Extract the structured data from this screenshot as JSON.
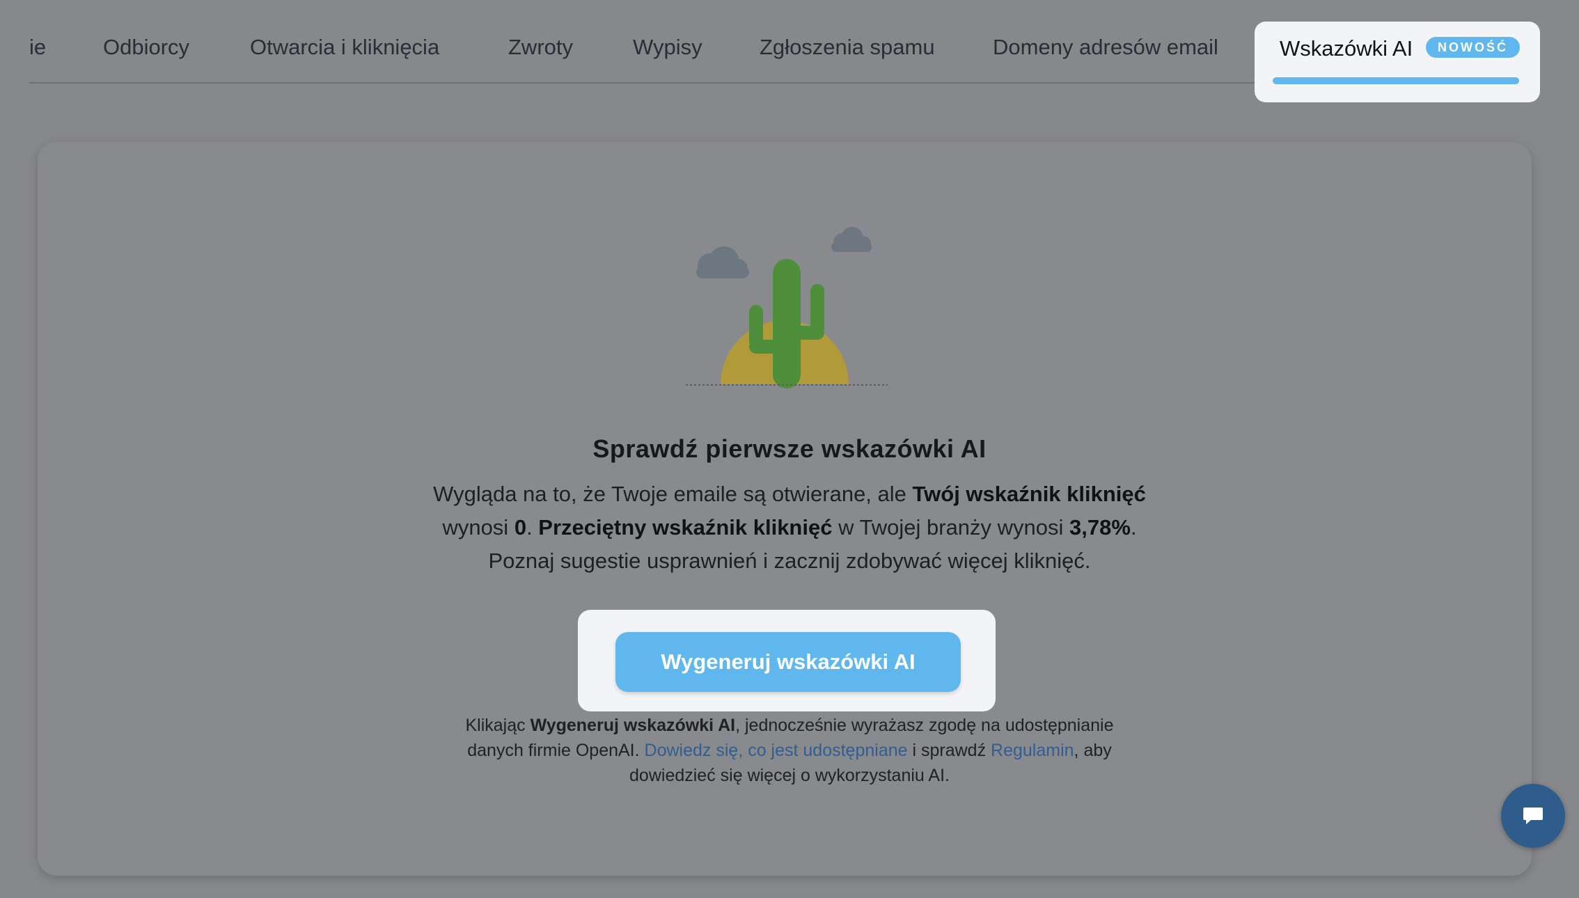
{
  "tabs": [
    {
      "label": "ie"
    },
    {
      "label": "Odbiorcy"
    },
    {
      "label": "Otwarcia i kliknięcia"
    },
    {
      "label": "Zwroty"
    },
    {
      "label": "Wypisy"
    },
    {
      "label": "Zgłoszenia spamu"
    },
    {
      "label": "Domeny adresów email"
    }
  ],
  "active_tab": {
    "label": "Wskazówki AI",
    "badge": "NOWOŚĆ"
  },
  "empty_state": {
    "illustration": "cactus-desert-icon",
    "heading": "Sprawdź pierwsze wskazówki AI",
    "desc_1": "Wygląda na to, że Twoje emaile są otwierane, ale ",
    "desc_bold_1": "Twój wskaźnik kliknięć",
    "desc_2": " wynosi ",
    "desc_bold_2": "0",
    "desc_3": ". ",
    "desc_bold_3": "Przeciętny wskaźnik kliknięć",
    "desc_4": " w Twojej branży wynosi ",
    "desc_bold_4": "3,78%",
    "desc_5": ". Poznaj sugestie usprawnień i zacznij zdobywać więcej kliknięć."
  },
  "cta": {
    "label": "Wygeneruj wskazówki AI"
  },
  "consent": {
    "part_1": "Klikając ",
    "bold": "Wygeneruj wskazówki AI",
    "part_2": ", jednocześnie wyrażasz zgodę na udostępnianie danych firmie OpenAI. ",
    "link_1": "Dowiedz się, co jest udostępniane",
    "part_3": " i sprawdź ",
    "link_2": "Regulamin",
    "part_4": ", aby dowiedzieć się więcej o wykorzystaniu AI."
  },
  "chat_widget": {
    "icon": "chat-bubble-icon"
  },
  "colors": {
    "accent": "#5fb7ee",
    "link": "#2f5e93",
    "overlay_bg": "#87888c",
    "highlight_bg": "#f3f4f7"
  }
}
